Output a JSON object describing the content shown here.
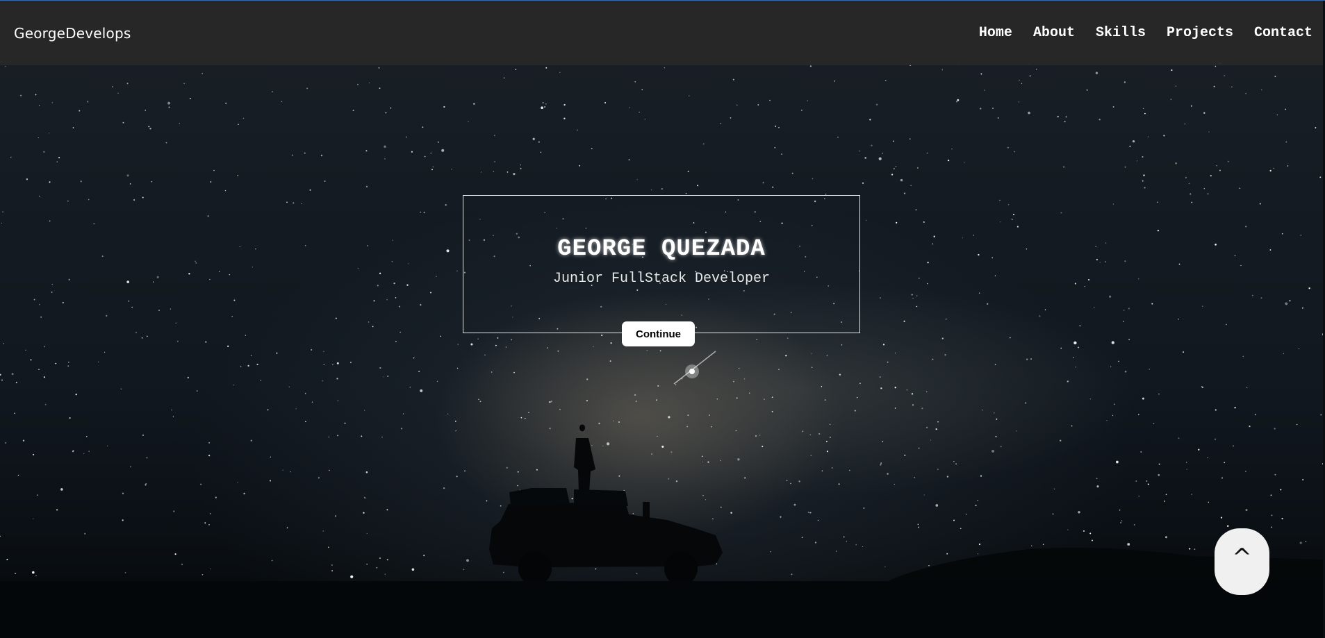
{
  "navbar": {
    "brand": "GeorgeDevelops",
    "links": [
      "Home",
      "About",
      "Skills",
      "Projects",
      "Contact"
    ]
  },
  "hero": {
    "name": "GEORGE QUEZADA",
    "subtitle": "Junior FullStack Developer",
    "continue_label": "Continue"
  },
  "scroll_top": {
    "label": "^"
  },
  "colors": {
    "navbar_bg": "#282828",
    "sky": "#141b22",
    "button_bg": "#ffffff",
    "scroll_button_bg": "#f0f0f0"
  },
  "icons": {
    "scroll_top": "caret-up-icon"
  }
}
